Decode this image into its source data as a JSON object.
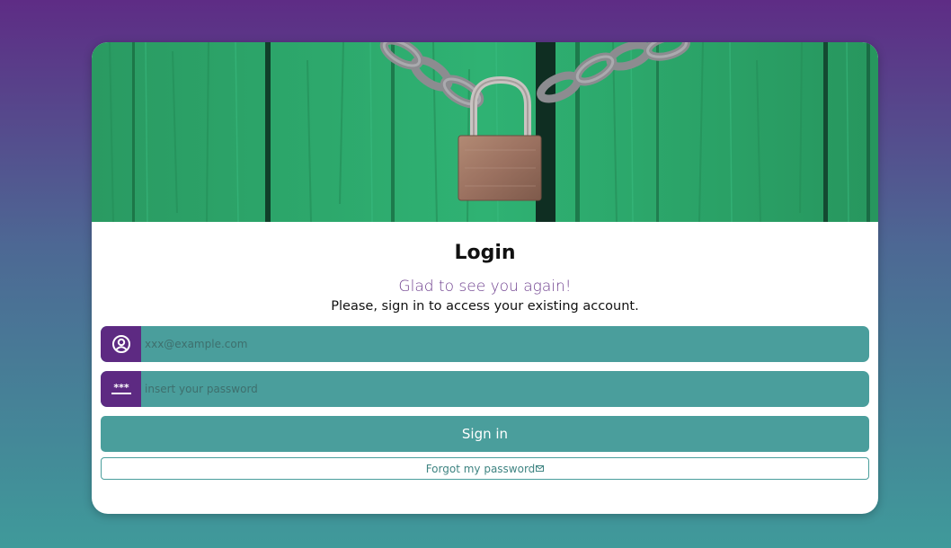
{
  "login": {
    "title": "Login",
    "subtitle": "Glad to see you again!",
    "description": "Please, sign in to access your existing account."
  },
  "email_field": {
    "icon": "user-circle-icon",
    "placeholder": "xxx@example.com",
    "value": ""
  },
  "password_field": {
    "icon": "password-icon",
    "placeholder": "insert your password",
    "value": ""
  },
  "buttons": {
    "sign_in": "Sign in",
    "forgot_password": "Forgot my password",
    "forgot_icon": "mail-icon"
  },
  "colors": {
    "brand_purple": "#5d2a82",
    "brand_teal": "#4a9e9c",
    "subtitle_purple": "#6e3f8e"
  }
}
